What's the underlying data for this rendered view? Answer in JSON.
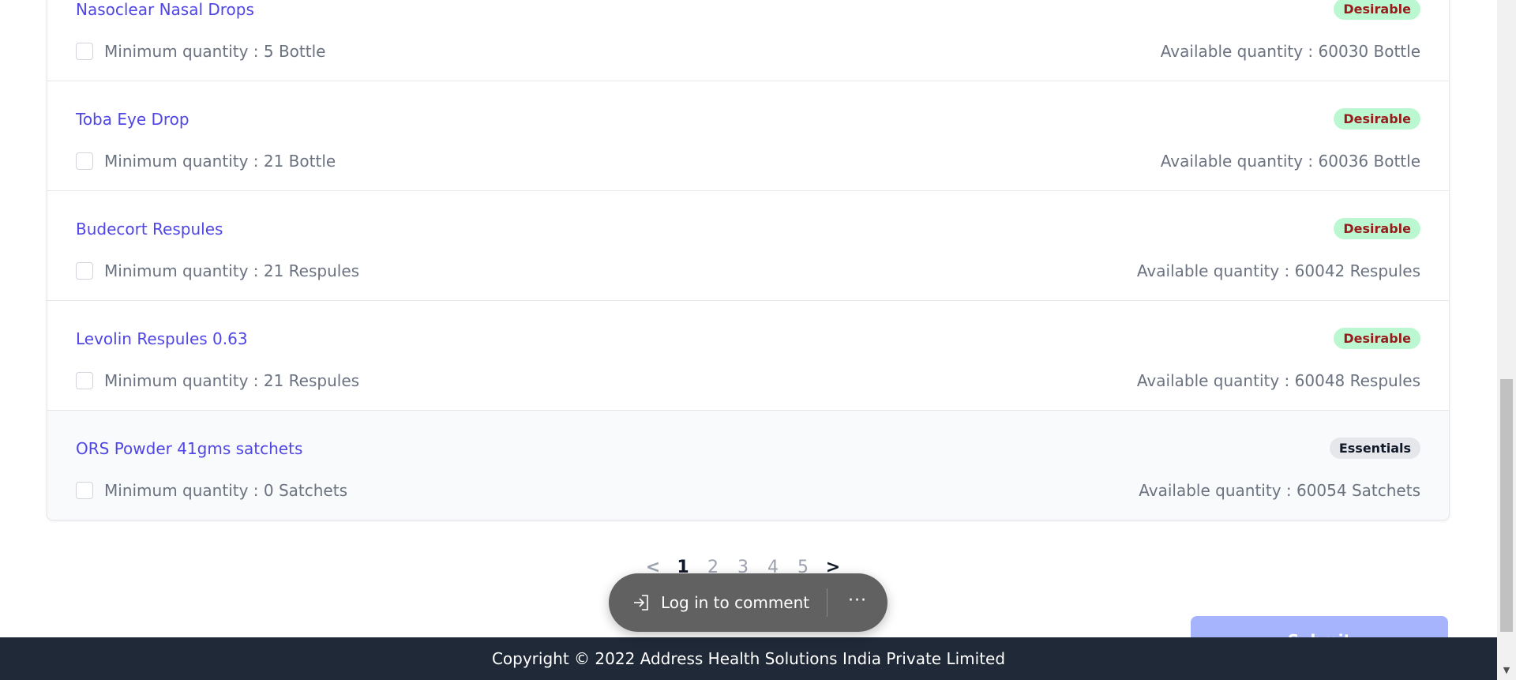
{
  "items": [
    {
      "name": "Nasoclear Nasal Drops",
      "badge": "Desirable",
      "min_qty": "Minimum quantity : 5 Bottle",
      "avail_qty": "Available quantity : 60030 Bottle"
    },
    {
      "name": "Toba Eye Drop",
      "badge": "Desirable",
      "min_qty": "Minimum quantity : 21 Bottle",
      "avail_qty": "Available quantity : 60036 Bottle"
    },
    {
      "name": "Budecort Respules",
      "badge": "Desirable",
      "min_qty": "Minimum quantity : 21 Respules",
      "avail_qty": "Available quantity : 60042 Respules"
    },
    {
      "name": "Levolin Respules 0.63",
      "badge": "Desirable",
      "min_qty": "Minimum quantity : 21 Respules",
      "avail_qty": "Available quantity : 60048 Respules"
    },
    {
      "name": "ORS Powder 41gms satchets",
      "badge": "Essentials",
      "min_qty": "Minimum quantity : 0 Satchets",
      "avail_qty": "Available quantity : 60054 Satchets"
    }
  ],
  "pagination": {
    "prev": "<",
    "pages": [
      "1",
      "2",
      "3",
      "4",
      "5"
    ],
    "current_page": "1",
    "next": ">"
  },
  "submit_label": "Submit",
  "comment_pill": {
    "login_label": "Log in to comment",
    "more_label": "···"
  },
  "footer": {
    "copyright": "Copyright © 2022 Address Health Solutions India Private Limited"
  }
}
